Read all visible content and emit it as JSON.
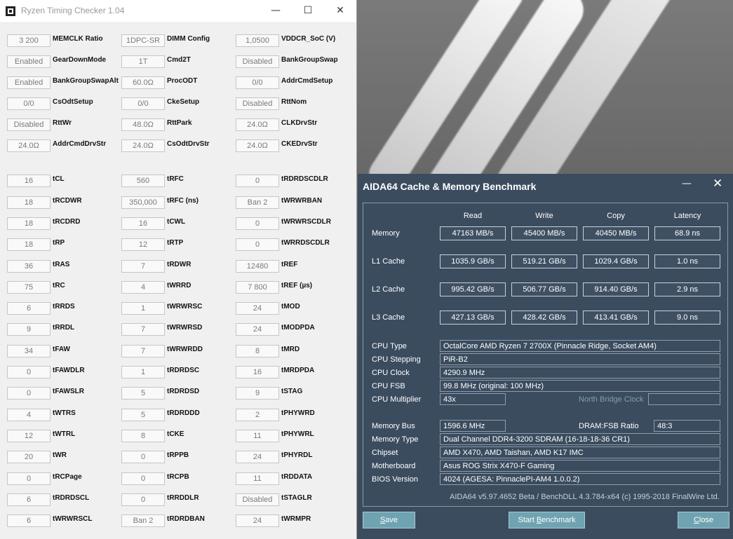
{
  "rtc": {
    "title": "Ryzen Timing Checker 1.04",
    "controls": {
      "minimize": "—",
      "maximize": "☐",
      "close": "✕"
    },
    "rows": [
      [
        {
          "value": "3 200",
          "label": "MEMCLK Ratio"
        },
        {
          "value": "1DPC-SR",
          "label": "DIMM Config"
        },
        {
          "value": "1,0500",
          "label": "VDDCR_SoC (V)"
        }
      ],
      [
        {
          "value": "Enabled",
          "label": "GearDownMode"
        },
        {
          "value": "1T",
          "label": "Cmd2T"
        },
        {
          "value": "Disabled",
          "label": "BankGroupSwap"
        }
      ],
      [
        {
          "value": "Enabled",
          "label": "BankGroupSwapAlt"
        },
        {
          "value": "60.0Ω",
          "label": "ProcODT"
        },
        {
          "value": "0/0",
          "label": "AddrCmdSetup"
        }
      ],
      [
        {
          "value": "0/0",
          "label": "CsOdtSetup"
        },
        {
          "value": "0/0",
          "label": "CkeSetup"
        },
        {
          "value": "Disabled",
          "label": "RttNom"
        }
      ],
      [
        {
          "value": "Disabled",
          "label": "RttWr"
        },
        {
          "value": "48.0Ω",
          "label": "RttPark"
        },
        {
          "value": "24.0Ω",
          "label": "CLKDrvStr"
        }
      ],
      [
        {
          "value": "24.0Ω",
          "label": "AddrCmdDrvStr"
        },
        {
          "value": "24.0Ω",
          "label": "CsOdtDrvStr"
        },
        {
          "value": "24.0Ω",
          "label": "CKEDrvStr"
        }
      ],
      [
        {
          "value": "16",
          "label": "tCL"
        },
        {
          "value": "560",
          "label": "tRFC"
        },
        {
          "value": "0",
          "label": "tRDRDSCDLR"
        }
      ],
      [
        {
          "value": "18",
          "label": "tRCDWR"
        },
        {
          "value": "350,000",
          "label": "tRFC (ns)"
        },
        {
          "value": "Ban 2",
          "label": "tWRWRBAN"
        }
      ],
      [
        {
          "value": "18",
          "label": "tRCDRD"
        },
        {
          "value": "16",
          "label": "tCWL"
        },
        {
          "value": "0",
          "label": "tWRWRSCDLR"
        }
      ],
      [
        {
          "value": "18",
          "label": "tRP"
        },
        {
          "value": "12",
          "label": "tRTP"
        },
        {
          "value": "0",
          "label": "tWRRDSCDLR"
        }
      ],
      [
        {
          "value": "36",
          "label": "tRAS"
        },
        {
          "value": "7",
          "label": "tRDWR"
        },
        {
          "value": "12480",
          "label": "tREF"
        }
      ],
      [
        {
          "value": "75",
          "label": "tRC"
        },
        {
          "value": "4",
          "label": "tWRRD"
        },
        {
          "value": "7 800",
          "label": "tREF (µs)"
        }
      ],
      [
        {
          "value": "6",
          "label": "tRRDS"
        },
        {
          "value": "1",
          "label": "tWRWRSC"
        },
        {
          "value": "24",
          "label": "tMOD"
        }
      ],
      [
        {
          "value": "9",
          "label": "tRRDL"
        },
        {
          "value": "7",
          "label": "tWRWRSD"
        },
        {
          "value": "24",
          "label": "tMODPDA"
        }
      ],
      [
        {
          "value": "34",
          "label": "tFAW"
        },
        {
          "value": "7",
          "label": "tWRWRDD"
        },
        {
          "value": "8",
          "label": "tMRD"
        }
      ],
      [
        {
          "value": "0",
          "label": "tFAWDLR"
        },
        {
          "value": "1",
          "label": "tRDRDSC"
        },
        {
          "value": "16",
          "label": "tMRDPDA"
        }
      ],
      [
        {
          "value": "0",
          "label": "tFAWSLR"
        },
        {
          "value": "5",
          "label": "tRDRDSD"
        },
        {
          "value": "9",
          "label": "tSTAG"
        }
      ],
      [
        {
          "value": "4",
          "label": "tWTRS"
        },
        {
          "value": "5",
          "label": "tRDRDDD"
        },
        {
          "value": "2",
          "label": "tPHYWRD"
        }
      ],
      [
        {
          "value": "12",
          "label": "tWTRL"
        },
        {
          "value": "8",
          "label": "tCKE"
        },
        {
          "value": "11",
          "label": "tPHYWRL"
        }
      ],
      [
        {
          "value": "20",
          "label": "tWR"
        },
        {
          "value": "0",
          "label": "tRPPB"
        },
        {
          "value": "24",
          "label": "tPHYRDL"
        }
      ],
      [
        {
          "value": "0",
          "label": "tRCPage"
        },
        {
          "value": "0",
          "label": "tRCPB"
        },
        {
          "value": "11",
          "label": "tRDDATA"
        }
      ],
      [
        {
          "value": "6",
          "label": "tRDRDSCL"
        },
        {
          "value": "0",
          "label": "tRRDDLR"
        },
        {
          "value": "Disabled",
          "label": "tSTAGLR"
        }
      ],
      [
        {
          "value": "6",
          "label": "tWRWRSCL"
        },
        {
          "value": "Ban 2",
          "label": "tRDRDBAN"
        },
        {
          "value": "24",
          "label": "tWRMPR"
        }
      ]
    ]
  },
  "aida": {
    "title": "AIDA64 Cache & Memory Benchmark",
    "controls": {
      "minimize": "—",
      "close": "✕"
    },
    "columns": [
      "Read",
      "Write",
      "Copy",
      "Latency"
    ],
    "bench_rows": [
      {
        "label": "Memory",
        "values": [
          "47163 MB/s",
          "45400 MB/s",
          "40450 MB/s",
          "68.9 ns"
        ]
      },
      {
        "label": "L1 Cache",
        "values": [
          "1035.9 GB/s",
          "519.21 GB/s",
          "1029.4 GB/s",
          "1.0 ns"
        ]
      },
      {
        "label": "L2 Cache",
        "values": [
          "995.42 GB/s",
          "506.77 GB/s",
          "914.40 GB/s",
          "2.9 ns"
        ]
      },
      {
        "label": "L3 Cache",
        "values": [
          "427.13 GB/s",
          "428.42 GB/s",
          "413.41 GB/s",
          "9.0 ns"
        ]
      }
    ],
    "info": {
      "cpu_type": {
        "label": "CPU Type",
        "value": "OctalCore AMD Ryzen 7 2700X  (Pinnacle Ridge, Socket AM4)"
      },
      "cpu_stepping": {
        "label": "CPU Stepping",
        "value": "PiR-B2"
      },
      "cpu_clock": {
        "label": "CPU Clock",
        "value": "4290.9 MHz"
      },
      "cpu_fsb": {
        "label": "CPU FSB",
        "value": "99.8 MHz  (original: 100 MHz)"
      },
      "cpu_multiplier": {
        "label": "CPU Multiplier",
        "value": "43x"
      },
      "nb_clock_label": "North Bridge Clock",
      "memory_bus": {
        "label": "Memory Bus",
        "value": "1596.6 MHz"
      },
      "dram_fsb": {
        "label": "DRAM:FSB Ratio",
        "value": "48:3"
      },
      "memory_type": {
        "label": "Memory Type",
        "value": "Dual Channel DDR4-3200 SDRAM  (16-18-18-36 CR1)"
      },
      "chipset": {
        "label": "Chipset",
        "value": "AMD X470, AMD Taishan, AMD K17 IMC"
      },
      "motherboard": {
        "label": "Motherboard",
        "value": "Asus ROG Strix X470-F Gaming"
      },
      "bios": {
        "label": "BIOS Version",
        "value": "4024  (AGESA: PinnaclePI-AM4 1.0.0.2)"
      }
    },
    "footer": "AIDA64 v5.97.4652 Beta / BenchDLL 4.3.784-x64  (c) 1995-2018 FinalWire Ltd.",
    "buttons": {
      "save": {
        "key": "S",
        "rest": "ave"
      },
      "start": {
        "pre": "Start ",
        "key": "B",
        "rest": "enchmark"
      },
      "close": {
        "key": "C",
        "rest": "lose"
      }
    }
  }
}
